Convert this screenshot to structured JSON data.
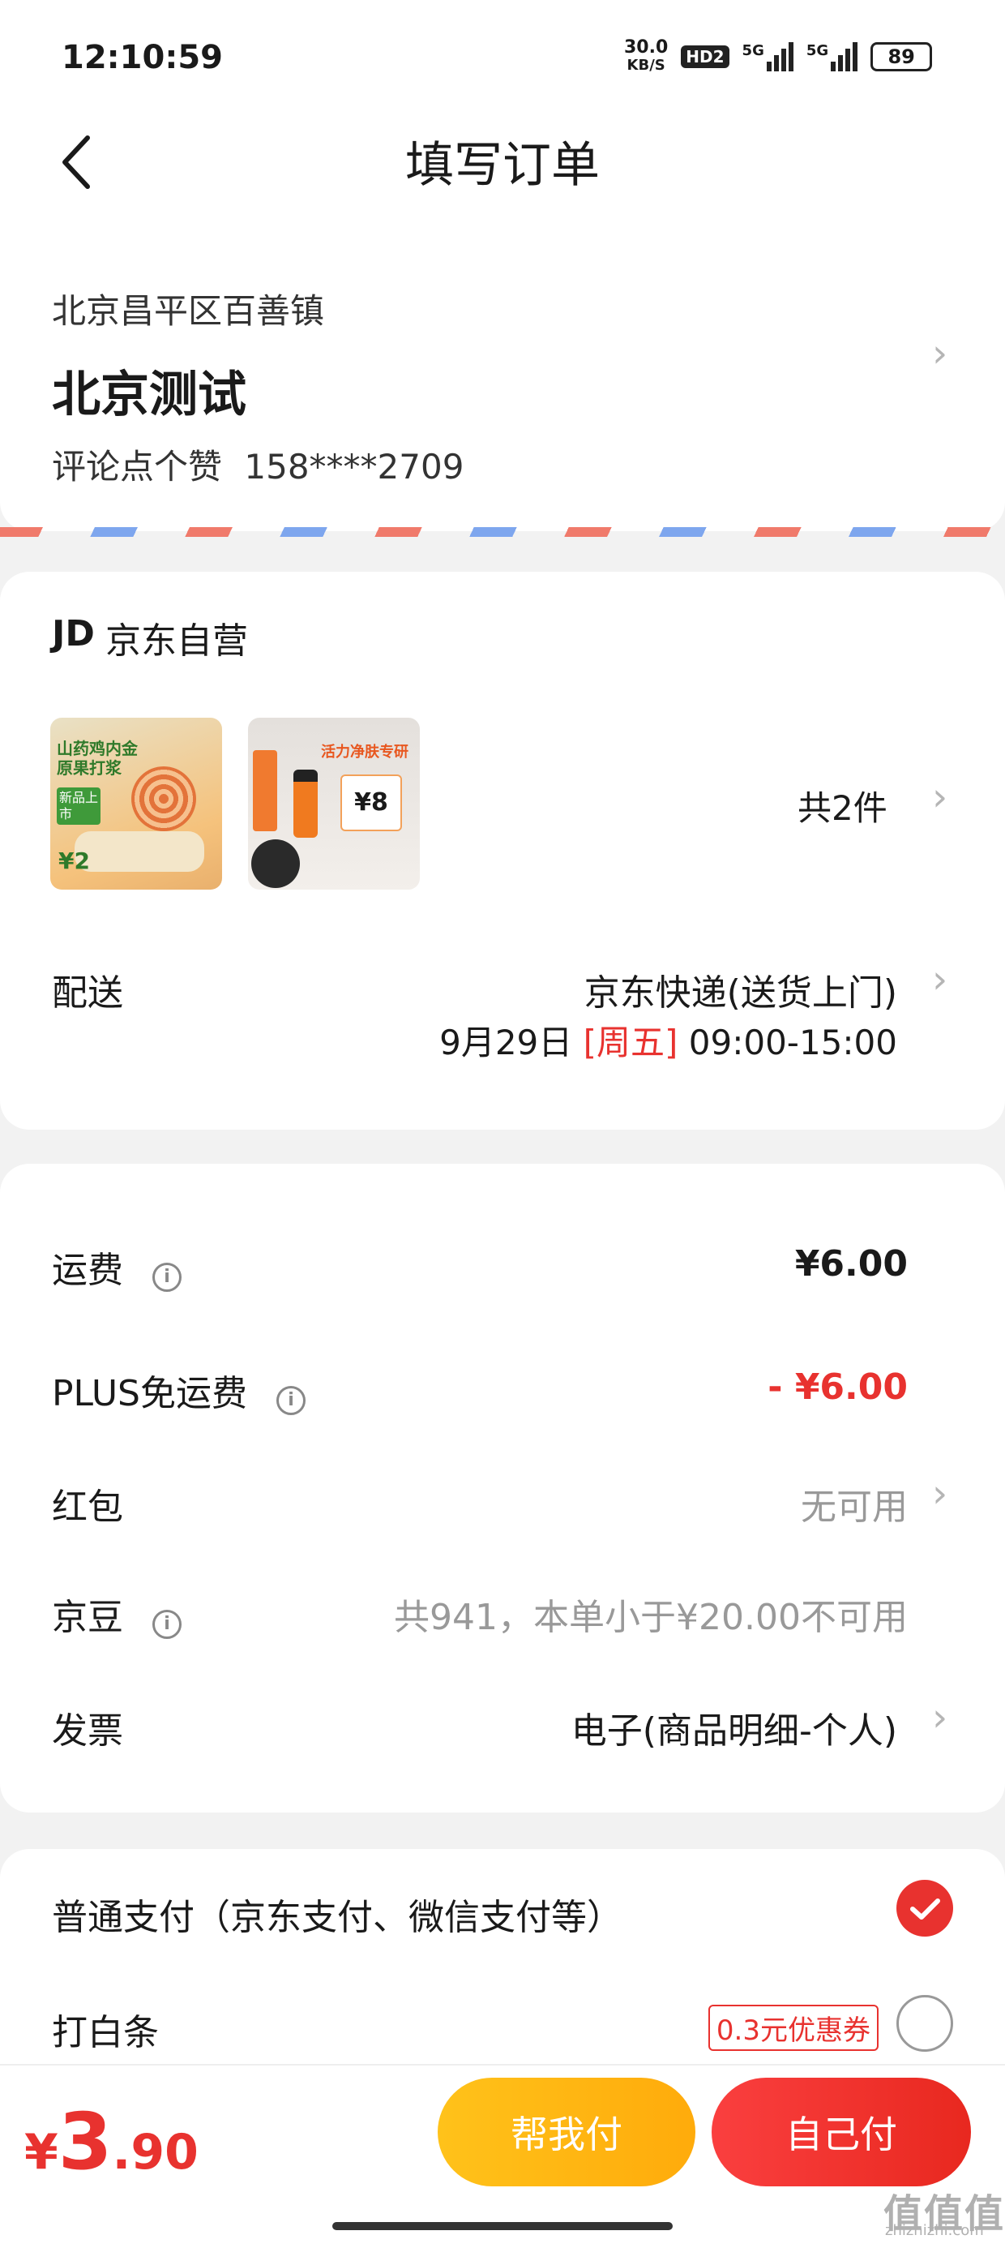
{
  "status_bar": {
    "time": "12:10:59",
    "net_speed": "30.0",
    "net_unit": "KB/S",
    "hd_label": "HD2",
    "sig1_label": "5G",
    "sig2_label": "5G",
    "battery": "89"
  },
  "header": {
    "title": "填写订单"
  },
  "address": {
    "region": "北京昌平区百善镇",
    "name": "北京测试",
    "contact_name": "评论点个赞",
    "phone": "158****2709"
  },
  "shop": {
    "logo": "JD",
    "name": "京东自营",
    "product1": {
      "line1": "山药鸡内金",
      "line2": "原果打浆",
      "tag": "新品上市",
      "price": "¥2"
    },
    "product2": {
      "headline": "活力净肤专研",
      "price": "¥8"
    },
    "count": "共2件",
    "delivery_label": "配送",
    "delivery_type": "京东快递(送货上门)",
    "delivery_date": "9月29日",
    "delivery_weekday": "[周五]",
    "delivery_window": "09:00-15:00"
  },
  "fees": {
    "freight_label": "运费",
    "freight_value": "¥6.00",
    "plus_label": "PLUS免运费",
    "plus_value": "- ¥6.00",
    "redpacket_label": "红包",
    "redpacket_value": "无可用",
    "jingdou_label": "京豆",
    "jingdou_value": "共941，本单小于¥20.00不可用",
    "invoice_label": "发票",
    "invoice_value": "电子(商品明细-个人)"
  },
  "payment": {
    "normal_label": "普通支付（京东支付、微信支付等）",
    "baitiao_label": "打白条",
    "coupon_badge": "0.3元优惠券"
  },
  "bottom": {
    "currency": "¥",
    "price_int": "3",
    "price_dec": ".90",
    "help_pay": "帮我付",
    "self_pay": "自己付"
  },
  "watermark": {
    "main": "值值值",
    "sub": "zhizhizhi.com"
  },
  "colors": {
    "accent": "#e8322f",
    "help_btn": "#ffb612",
    "info_icon": "#888888"
  },
  "icons": [
    "back-chevron-icon",
    "chevron-right-icon",
    "info-icon",
    "check-circle-icon"
  ]
}
